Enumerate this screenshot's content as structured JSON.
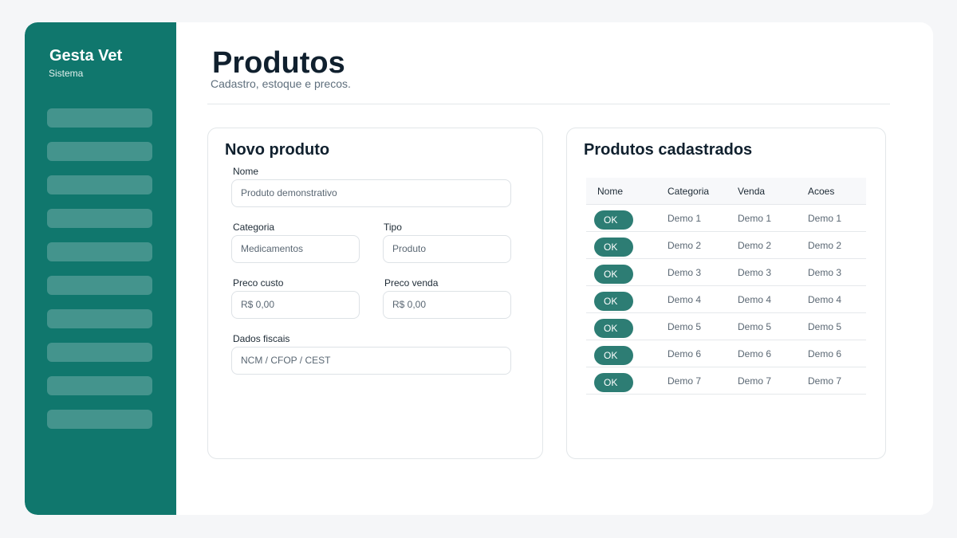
{
  "sidebar": {
    "brand": "Gesta Vet",
    "brand_sub": "Sistema",
    "nav_items": 10
  },
  "header": {
    "title": "Produtos",
    "subtitle": "Cadastro, estoque e precos."
  },
  "form": {
    "title": "Novo produto",
    "nome": {
      "label": "Nome",
      "value": "Produto demonstrativo"
    },
    "categoria": {
      "label": "Categoria",
      "value": "Medicamentos"
    },
    "tipo": {
      "label": "Tipo",
      "value": "Produto"
    },
    "preco_custo": {
      "label": "Preco custo",
      "value": "R$ 0,00"
    },
    "preco_venda": {
      "label": "Preco venda",
      "value": "R$ 0,00"
    },
    "dados_fiscais": {
      "label": "Dados fiscais",
      "value": "NCM / CFOP / CEST"
    }
  },
  "list": {
    "title": "Produtos cadastrados",
    "columns": [
      "Nome",
      "Categoria",
      "Venda",
      "Acoes"
    ],
    "rows": [
      {
        "action": "OK",
        "categoria": "Demo 1",
        "venda": "Demo 1",
        "acoes": "Demo 1"
      },
      {
        "action": "OK",
        "categoria": "Demo 2",
        "venda": "Demo 2",
        "acoes": "Demo 2"
      },
      {
        "action": "OK",
        "categoria": "Demo 3",
        "venda": "Demo 3",
        "acoes": "Demo 3"
      },
      {
        "action": "OK",
        "categoria": "Demo 4",
        "venda": "Demo 4",
        "acoes": "Demo 4"
      },
      {
        "action": "OK",
        "categoria": "Demo 5",
        "venda": "Demo 5",
        "acoes": "Demo 5"
      },
      {
        "action": "OK",
        "categoria": "Demo 6",
        "venda": "Demo 6",
        "acoes": "Demo 6"
      },
      {
        "action": "OK",
        "categoria": "Demo 7",
        "venda": "Demo 7",
        "acoes": "Demo 7"
      }
    ]
  },
  "colors": {
    "brand": "#10776d",
    "button": "#2d7d74"
  }
}
